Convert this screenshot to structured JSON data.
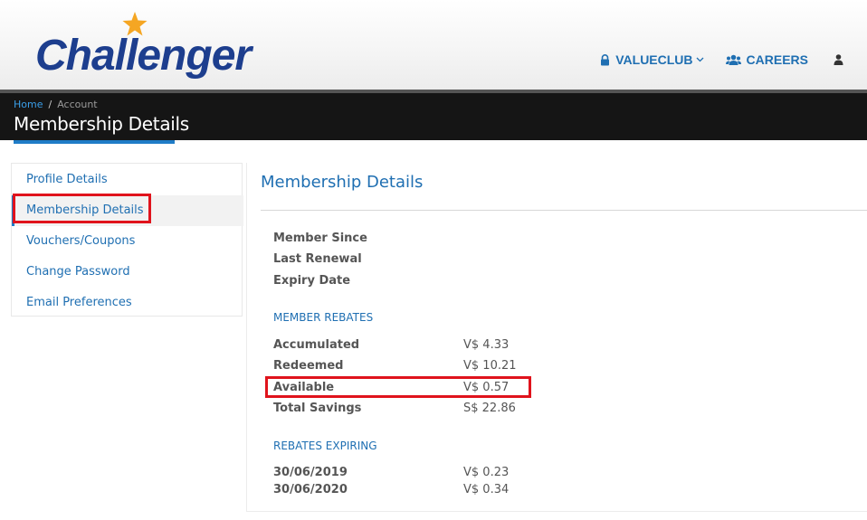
{
  "header": {
    "logo_text": "Challenger",
    "nav": {
      "valueclub_label": "VALUECLUB",
      "careers_label": "CAREERS"
    }
  },
  "breadcrumb": {
    "home": "Home",
    "separator": "/",
    "current": "Account"
  },
  "page": {
    "title": "Membership Details"
  },
  "sidebar": {
    "items": [
      {
        "label": "Profile Details",
        "active": false
      },
      {
        "label": "Membership Details",
        "active": true
      },
      {
        "label": "Vouchers/Coupons",
        "active": false
      },
      {
        "label": "Change Password",
        "active": false
      },
      {
        "label": "Email Preferences",
        "active": false
      }
    ]
  },
  "main": {
    "title": "Membership Details",
    "membership": [
      {
        "label": "Member Since",
        "value": ""
      },
      {
        "label": "Last Renewal",
        "value": ""
      },
      {
        "label": "Expiry Date",
        "value": ""
      }
    ],
    "rebates_heading": "MEMBER REBATES",
    "rebates": [
      {
        "label": "Accumulated",
        "value": "V$ 4.33"
      },
      {
        "label": "Redeemed",
        "value": "V$ 10.21"
      },
      {
        "label": "Available",
        "value": "V$ 0.57"
      },
      {
        "label": "Total Savings",
        "value": "S$ 22.86"
      }
    ],
    "expiring_heading": "REBATES EXPIRING",
    "expiring": [
      {
        "label": "30/06/2019",
        "value": "V$ 0.23"
      },
      {
        "label": "30/06/2020",
        "value": "V$ 0.34"
      }
    ]
  },
  "colors": {
    "brand_blue": "#1d3e8e",
    "link_blue": "#1f6fb2",
    "accent_blue": "#1f7cc7",
    "highlight_red": "#e0131c",
    "star_orange": "#f5a623"
  },
  "icons": {
    "lock": "lock-icon",
    "chevron": "chevron-down-icon",
    "careers": "users-icon",
    "user": "user-icon"
  }
}
